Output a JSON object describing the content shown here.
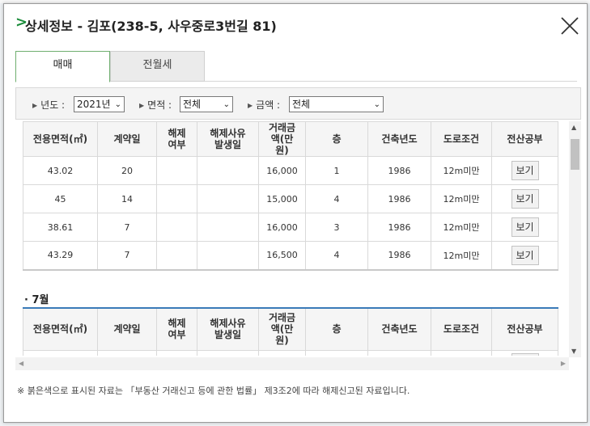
{
  "dialog": {
    "title": "상세정보 - 김포(238-5, 사우중로3번길 81)",
    "close_label": "×"
  },
  "tabs": [
    {
      "label": "매매",
      "active": true
    },
    {
      "label": "전월세",
      "active": false
    }
  ],
  "filters": {
    "year": {
      "label": "년도 :",
      "value": "2021년"
    },
    "area": {
      "label": "면적 :",
      "value": "전체"
    },
    "price": {
      "label": "금액 :",
      "value": "전체"
    }
  },
  "table": {
    "headers": [
      "전용면적(㎡)",
      "계약일",
      "해제\n여부",
      "해제사유\n발생일",
      "거래금\n액(만\n원)",
      "층",
      "건축년도",
      "도로조건",
      "전산공부"
    ],
    "rows": [
      {
        "area": "43.02",
        "day": "20",
        "cancel": "",
        "cancel_date": "",
        "price": "16,000",
        "floor": "1",
        "year": "1986",
        "road": "12m미만",
        "btn": "보기"
      },
      {
        "area": "45",
        "day": "14",
        "cancel": "",
        "cancel_date": "",
        "price": "15,000",
        "floor": "4",
        "year": "1986",
        "road": "12m미만",
        "btn": "보기"
      },
      {
        "area": "38.61",
        "day": "7",
        "cancel": "",
        "cancel_date": "",
        "price": "16,000",
        "floor": "3",
        "year": "1986",
        "road": "12m미만",
        "btn": "보기"
      },
      {
        "area": "43.29",
        "day": "7",
        "cancel": "",
        "cancel_date": "",
        "price": "16,500",
        "floor": "4",
        "year": "1986",
        "road": "12m미만",
        "btn": "보기"
      }
    ]
  },
  "month_section": {
    "label": "· 7월"
  },
  "footnote": "※ 붉은색으로 표시된 자료는 「부동산 거래신고 등에 관한 법률」 제3조2에 따라 해제신고된 자료입니다."
}
